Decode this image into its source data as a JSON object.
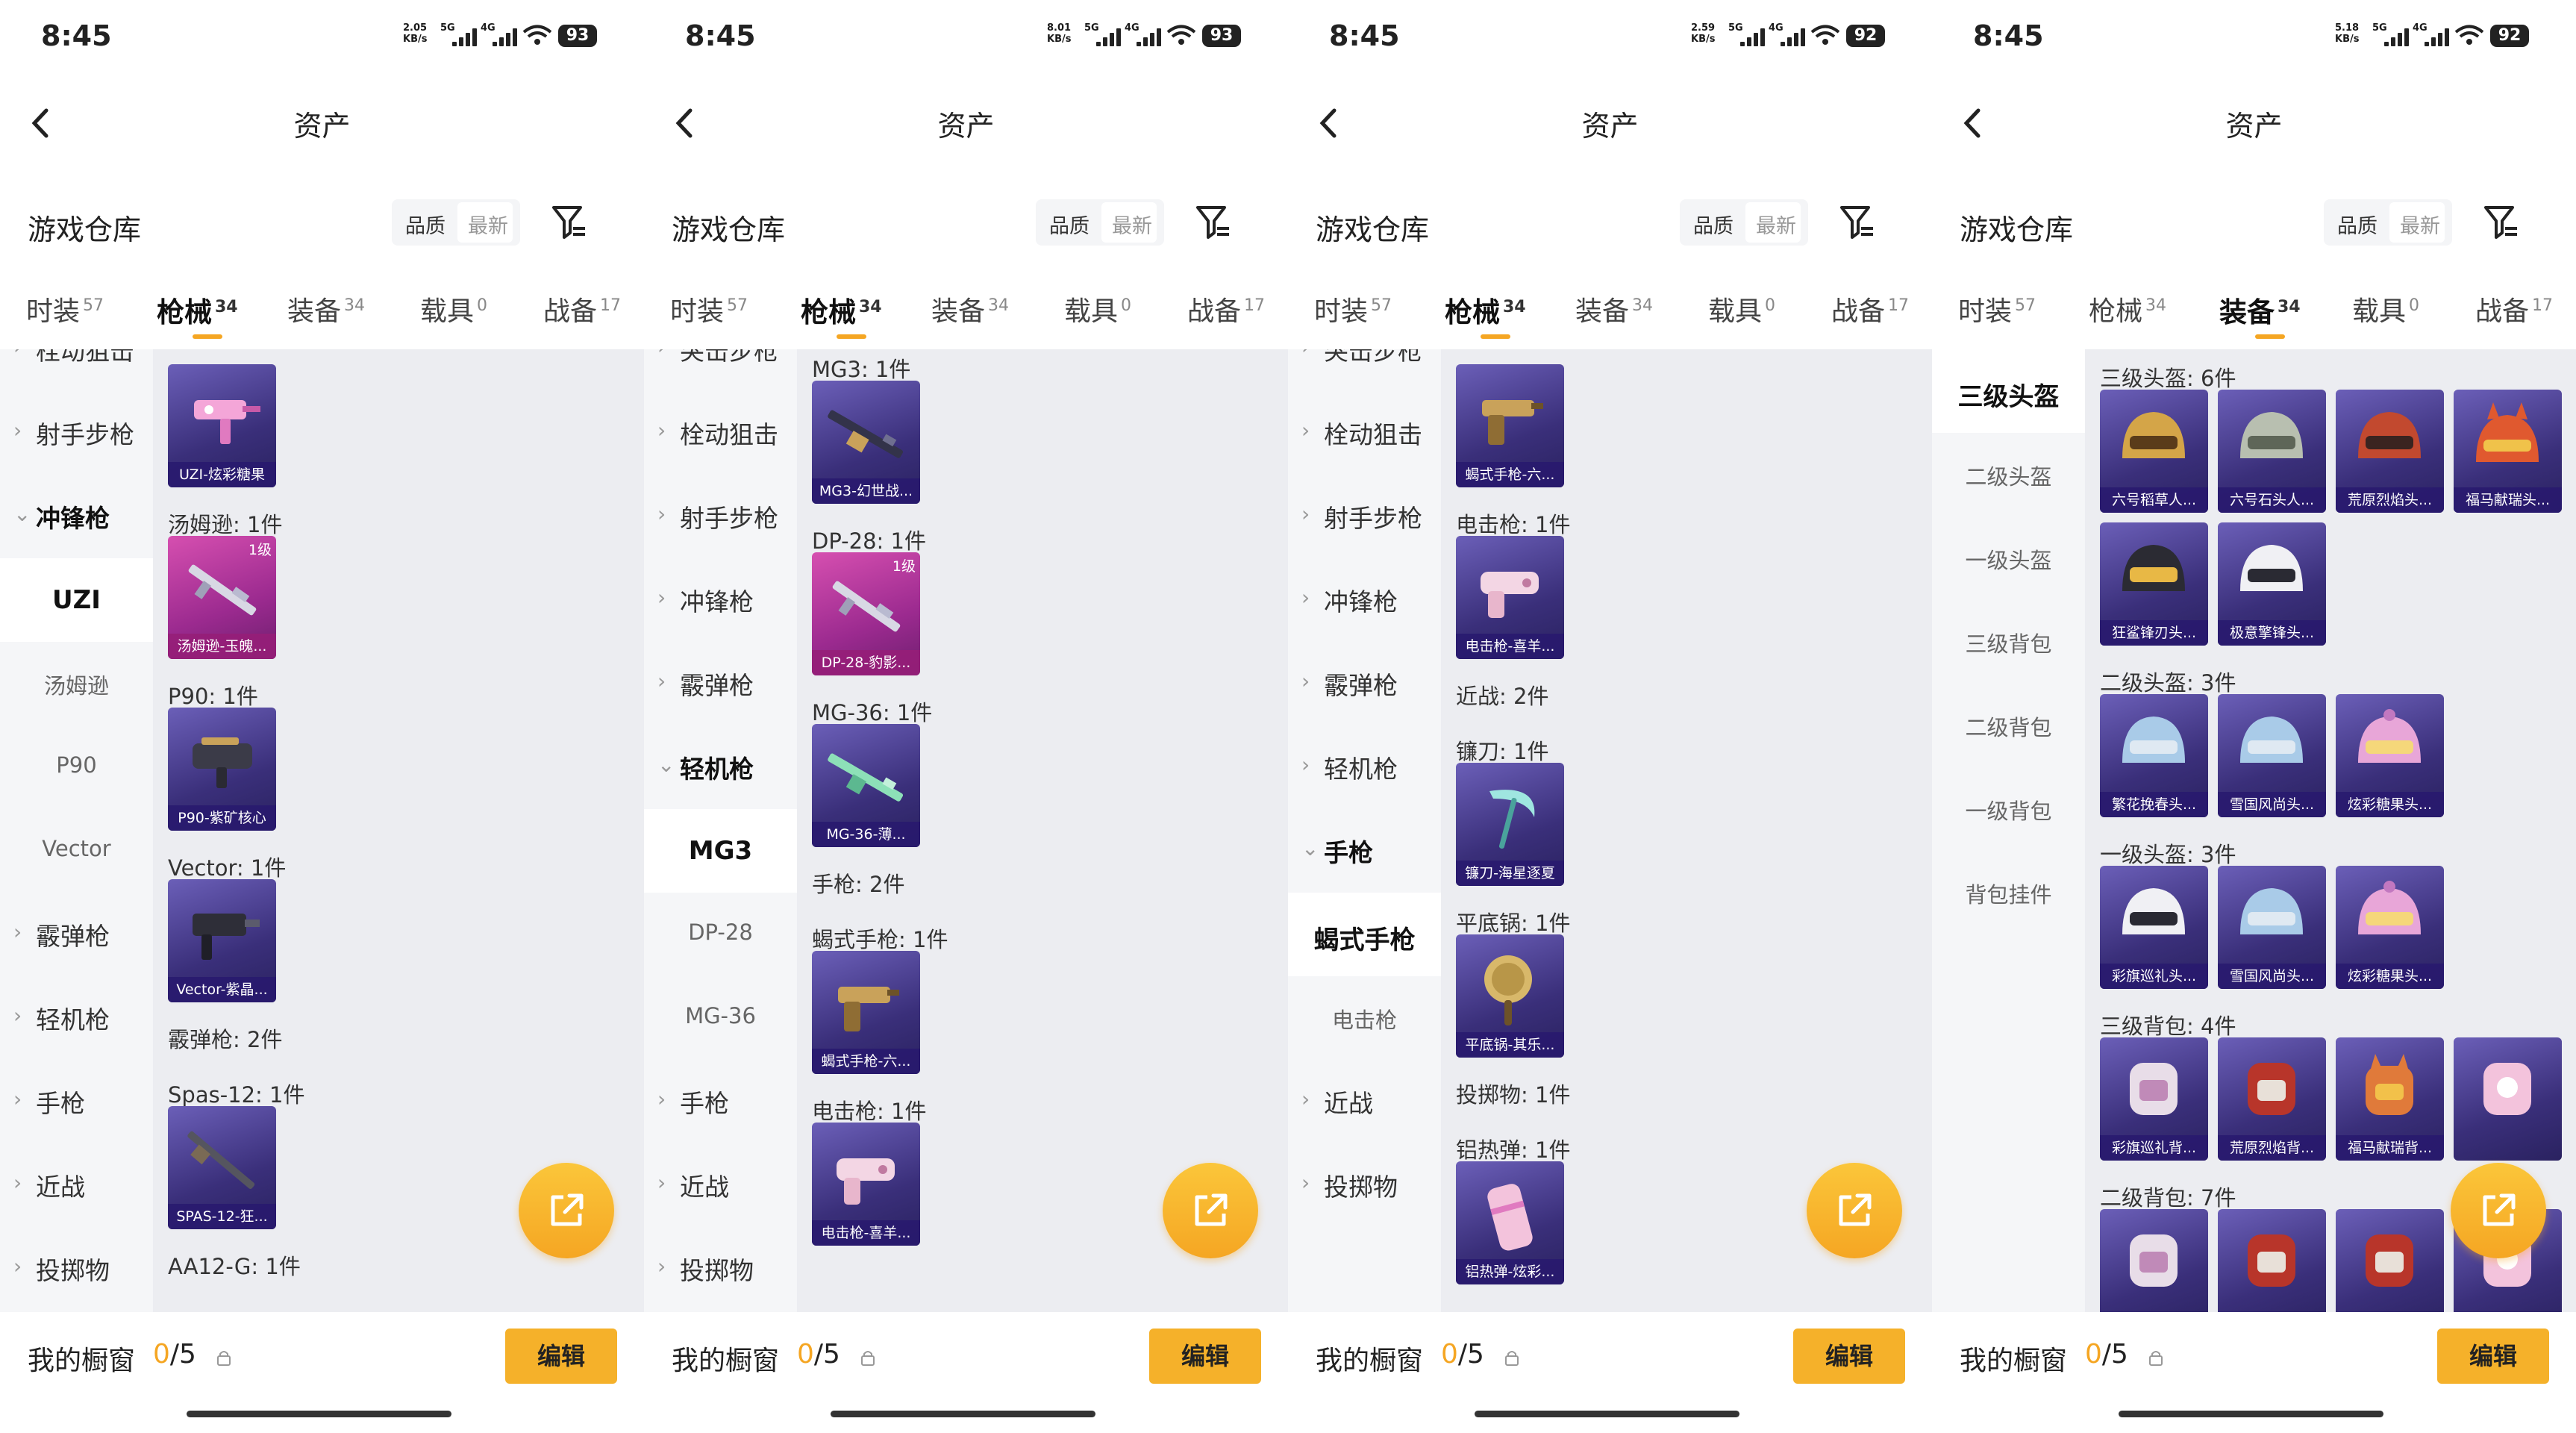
{
  "screens": [
    {
      "status": {
        "time": "8:45",
        "speed": "2.05",
        "speed_unit": "KB/s",
        "net1": "5G",
        "net2": "4G",
        "battery": "93"
      },
      "nav": {
        "title": "资产"
      },
      "header": {
        "warehouse": "游戏仓库",
        "sort_quality": "品质",
        "sort_newest": "最新"
      },
      "tabs": [
        {
          "label": "时装",
          "count": "57"
        },
        {
          "label": "枪械",
          "count": "34"
        },
        {
          "label": "装备",
          "count": "34"
        },
        {
          "label": "载具",
          "count": "0"
        },
        {
          "label": "战备",
          "count": "17"
        }
      ],
      "active_tab": 1,
      "sidebar": [
        {
          "label": "栓动狙击",
          "kind": "cat"
        },
        {
          "label": "射手步枪",
          "kind": "cat"
        },
        {
          "label": "冲锋枪",
          "kind": "open"
        },
        {
          "label": "UZI",
          "kind": "sel"
        },
        {
          "label": "汤姆逊",
          "kind": "sub"
        },
        {
          "label": "P90",
          "kind": "sub"
        },
        {
          "label": "Vector",
          "kind": "sub"
        },
        {
          "label": "霰弹枪",
          "kind": "cat"
        },
        {
          "label": "轻机枪",
          "kind": "cat"
        },
        {
          "label": "手枪",
          "kind": "cat"
        },
        {
          "label": "近战",
          "kind": "cat"
        },
        {
          "label": "投掷物",
          "kind": "cat"
        }
      ],
      "groups": [
        {
          "title": "",
          "items": [
            {
              "caption": "UZI-炫彩糖果",
              "style": "purple",
              "art": "smg-pink"
            }
          ]
        },
        {
          "title": "汤姆逊: 1件",
          "items": [
            {
              "caption": "汤姆逊-玉魄...",
              "style": "pink",
              "level": "1级",
              "art": "rifle"
            }
          ]
        },
        {
          "title": "P90: 1件",
          "items": [
            {
              "caption": "P90-紫矿核心",
              "style": "purple",
              "art": "p90"
            }
          ]
        },
        {
          "title": "Vector: 1件",
          "items": [
            {
              "caption": "Vector-紫晶...",
              "style": "purple",
              "art": "vector"
            }
          ]
        },
        {
          "title": "霰弹枪: 2件",
          "items": []
        },
        {
          "title": "Spas-12: 1件",
          "items": [
            {
              "caption": "SPAS-12-狂...",
              "style": "purple",
              "art": "shotgun"
            }
          ]
        },
        {
          "title": "AA12-G: 1件",
          "items": []
        }
      ],
      "footer": {
        "label": "我的橱窗",
        "count_zero": "0",
        "count_total": "/5",
        "edit": "编辑"
      }
    },
    {
      "status": {
        "time": "8:45",
        "speed": "8.01",
        "speed_unit": "KB/s",
        "net1": "5G",
        "net2": "4G",
        "battery": "93"
      },
      "nav": {
        "title": "资产"
      },
      "header": {
        "warehouse": "游戏仓库",
        "sort_quality": "品质",
        "sort_newest": "最新"
      },
      "tabs": [
        {
          "label": "时装",
          "count": "57"
        },
        {
          "label": "枪械",
          "count": "34"
        },
        {
          "label": "装备",
          "count": "34"
        },
        {
          "label": "载具",
          "count": "0"
        },
        {
          "label": "战备",
          "count": "17"
        }
      ],
      "active_tab": 1,
      "sidebar": [
        {
          "label": "突击步枪",
          "kind": "cat"
        },
        {
          "label": "栓动狙击",
          "kind": "cat"
        },
        {
          "label": "射手步枪",
          "kind": "cat"
        },
        {
          "label": "冲锋枪",
          "kind": "cat"
        },
        {
          "label": "霰弹枪",
          "kind": "cat"
        },
        {
          "label": "轻机枪",
          "kind": "open"
        },
        {
          "label": "MG3",
          "kind": "sel"
        },
        {
          "label": "DP-28",
          "kind": "sub"
        },
        {
          "label": "MG-36",
          "kind": "sub"
        },
        {
          "label": "手枪",
          "kind": "cat"
        },
        {
          "label": "近战",
          "kind": "cat"
        },
        {
          "label": "投掷物",
          "kind": "cat"
        }
      ],
      "groups": [
        {
          "title": "MG3: 1件",
          "items": [
            {
              "caption": "MG3-幻世战...",
              "style": "purple",
              "art": "lmg"
            }
          ]
        },
        {
          "title": "DP-28: 1件",
          "items": [
            {
              "caption": "DP-28-豹影...",
              "style": "pink",
              "level": "1级",
              "art": "rifle"
            }
          ]
        },
        {
          "title": "MG-36: 1件",
          "items": [
            {
              "caption": "MG-36-薄...",
              "style": "purple",
              "art": "lmg-green"
            }
          ]
        },
        {
          "title": "手枪: 2件",
          "items": []
        },
        {
          "title": "蝎式手枪: 1件",
          "items": [
            {
              "caption": "蝎式手枪-六...",
              "style": "purple",
              "art": "pistol-gold"
            }
          ]
        },
        {
          "title": "电击枪: 1件",
          "items": [
            {
              "caption": "电击枪-喜羊...",
              "style": "purple",
              "art": "taser"
            }
          ]
        }
      ],
      "footer": {
        "label": "我的橱窗",
        "count_zero": "0",
        "count_total": "/5",
        "edit": "编辑"
      }
    },
    {
      "status": {
        "time": "8:45",
        "speed": "2.59",
        "speed_unit": "KB/s",
        "net1": "5G",
        "net2": "4G",
        "battery": "92"
      },
      "nav": {
        "title": "资产"
      },
      "header": {
        "warehouse": "游戏仓库",
        "sort_quality": "品质",
        "sort_newest": "最新"
      },
      "tabs": [
        {
          "label": "时装",
          "count": "57"
        },
        {
          "label": "枪械",
          "count": "34"
        },
        {
          "label": "装备",
          "count": "34"
        },
        {
          "label": "载具",
          "count": "0"
        },
        {
          "label": "战备",
          "count": "17"
        }
      ],
      "active_tab": 1,
      "sidebar": [
        {
          "label": "突击步枪",
          "kind": "cat"
        },
        {
          "label": "栓动狙击",
          "kind": "cat"
        },
        {
          "label": "射手步枪",
          "kind": "cat"
        },
        {
          "label": "冲锋枪",
          "kind": "cat"
        },
        {
          "label": "霰弹枪",
          "kind": "cat"
        },
        {
          "label": "轻机枪",
          "kind": "cat"
        },
        {
          "label": "手枪",
          "kind": "open"
        },
        {
          "label": "蝎式手枪",
          "kind": "sel"
        },
        {
          "label": "电击枪",
          "kind": "sub"
        },
        {
          "label": "近战",
          "kind": "cat"
        },
        {
          "label": "投掷物",
          "kind": "cat"
        }
      ],
      "groups": [
        {
          "title": "",
          "items": [
            {
              "caption": "蝎式手枪-六...",
              "style": "purple",
              "art": "pistol-gold"
            }
          ]
        },
        {
          "title": "电击枪: 1件",
          "items": [
            {
              "caption": "电击枪-喜羊...",
              "style": "purple",
              "art": "taser"
            }
          ]
        },
        {
          "title": "近战: 2件",
          "items": []
        },
        {
          "title": "镰刀: 1件",
          "items": [
            {
              "caption": "镰刀-海星逐夏",
              "style": "purple",
              "art": "sickle"
            }
          ]
        },
        {
          "title": "平底锅: 1件",
          "items": [
            {
              "caption": "平底锅-其乐...",
              "style": "purple",
              "art": "pan"
            }
          ]
        },
        {
          "title": "投掷物: 1件",
          "items": []
        },
        {
          "title": "铝热弹: 1件",
          "items": [
            {
              "caption": "铝热弹-炫彩...",
              "style": "purple",
              "art": "grenade"
            }
          ]
        }
      ],
      "footer": {
        "label": "我的橱窗",
        "count_zero": "0",
        "count_total": "/5",
        "edit": "编辑"
      }
    },
    {
      "status": {
        "time": "8:45",
        "speed": "5.18",
        "speed_unit": "KB/s",
        "net1": "5G",
        "net2": "4G",
        "battery": "92"
      },
      "nav": {
        "title": "资产"
      },
      "header": {
        "warehouse": "游戏仓库",
        "sort_quality": "品质",
        "sort_newest": "最新"
      },
      "tabs": [
        {
          "label": "时装",
          "count": "57"
        },
        {
          "label": "枪械",
          "count": "34"
        },
        {
          "label": "装备",
          "count": "34"
        },
        {
          "label": "载具",
          "count": "0"
        },
        {
          "label": "战备",
          "count": "17"
        }
      ],
      "active_tab": 2,
      "sidebar": [
        {
          "label": "三级头盔",
          "kind": "sel"
        },
        {
          "label": "二级头盔",
          "kind": "sub"
        },
        {
          "label": "一级头盔",
          "kind": "sub"
        },
        {
          "label": "三级背包",
          "kind": "sub"
        },
        {
          "label": "二级背包",
          "kind": "sub"
        },
        {
          "label": "一级背包",
          "kind": "sub"
        },
        {
          "label": "背包挂件",
          "kind": "sub"
        }
      ],
      "groups": [
        {
          "title": "三级头盔: 6件",
          "items": [
            {
              "caption": "六号稻草人...",
              "style": "purple",
              "art": "helmet-gold"
            },
            {
              "caption": "六号石头人...",
              "style": "purple",
              "art": "helmet-stone"
            },
            {
              "caption": "荒原烈焰头...",
              "style": "purple",
              "art": "helmet-red"
            },
            {
              "caption": "福马献瑞头...",
              "style": "purple",
              "art": "helmet-horse"
            },
            {
              "caption": "狂鲨锋刃头...",
              "style": "purple",
              "art": "helmet-shark"
            },
            {
              "caption": "极意擎锋头...",
              "style": "purple",
              "art": "helmet-white"
            }
          ]
        },
        {
          "title": "二级头盔: 3件",
          "items": [
            {
              "caption": "繁花挽春头...",
              "style": "purple",
              "art": "helmet-blue"
            },
            {
              "caption": "雪国风尚头...",
              "style": "purple",
              "art": "helmet-blue"
            },
            {
              "caption": "炫彩糖果头...",
              "style": "purple",
              "art": "helmet-pink"
            }
          ]
        },
        {
          "title": "一级头盔: 3件",
          "items": [
            {
              "caption": "彩旗巡礼头...",
              "style": "purple",
              "art": "helmet-white"
            },
            {
              "caption": "雪国风尚头...",
              "style": "purple",
              "art": "helmet-blue"
            },
            {
              "caption": "炫彩糖果头...",
              "style": "purple",
              "art": "helmet-pink"
            }
          ]
        },
        {
          "title": "三级背包: 4件",
          "items": [
            {
              "caption": "彩旗巡礼背...",
              "style": "purple",
              "art": "bag-white"
            },
            {
              "caption": "荒原烈焰背...",
              "style": "purple",
              "art": "bag-red"
            },
            {
              "caption": "福马献瑞背...",
              "style": "purple",
              "art": "bag-horse"
            },
            {
              "caption": "",
              "style": "purple",
              "art": "bag-pink"
            }
          ]
        },
        {
          "title": "二级背包: 7件",
          "items": [
            {
              "caption": "",
              "style": "purple",
              "art": "bag-white"
            },
            {
              "caption": "",
              "style": "purple",
              "art": "bag-red"
            },
            {
              "caption": "",
              "style": "purple",
              "art": "bag-red"
            },
            {
              "caption": "",
              "style": "purple",
              "art": "bag-pink"
            }
          ]
        }
      ],
      "footer": {
        "label": "我的橱窗",
        "count_zero": "0",
        "count_total": "/5",
        "edit": "编辑"
      }
    }
  ]
}
